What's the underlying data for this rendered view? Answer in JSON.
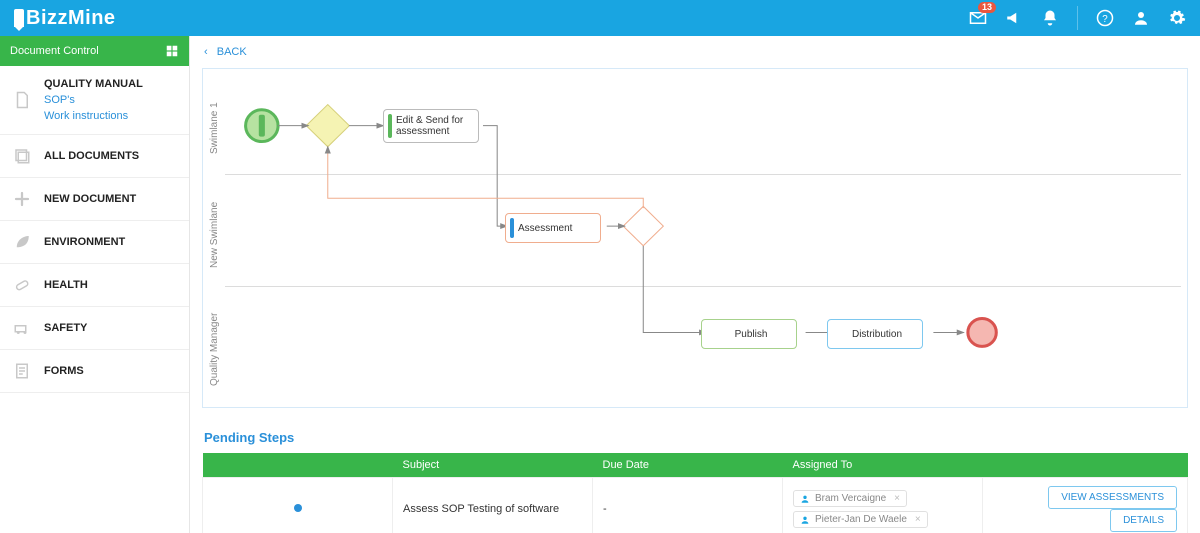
{
  "brand": "BizzMine",
  "header": {
    "badge": "13"
  },
  "sidebar": {
    "header": "Document Control",
    "items": [
      {
        "title": "QUALITY MANUAL",
        "links": [
          "SOP's",
          "Work instructions"
        ]
      },
      {
        "title": "ALL DOCUMENTS"
      },
      {
        "title": "NEW DOCUMENT"
      },
      {
        "title": "ENVIRONMENT"
      },
      {
        "title": "HEALTH"
      },
      {
        "title": "SAFETY"
      },
      {
        "title": "FORMS"
      }
    ]
  },
  "crumbs": {
    "back": "BACK"
  },
  "diagram": {
    "lanes": [
      "Swimlane 1",
      "New Swimlane",
      "Quality Manager"
    ],
    "tasks": {
      "edit": "Edit & Send for assessment",
      "assess": "Assessment",
      "publish": "Publish",
      "dist": "Distribution"
    }
  },
  "pending": {
    "title": "Pending Steps",
    "columns": {
      "status": "",
      "subject": "Subject",
      "due": "Due Date",
      "assigned": "Assigned To",
      "actions": ""
    },
    "rows": [
      {
        "subject": "Assess SOP Testing of software",
        "due": "-",
        "assignees": [
          "Bram Vercaigne",
          "Pieter-Jan De Waele"
        ]
      }
    ],
    "actions": {
      "view": "VIEW ASSESSMENTS",
      "details": "DETAILS"
    }
  }
}
